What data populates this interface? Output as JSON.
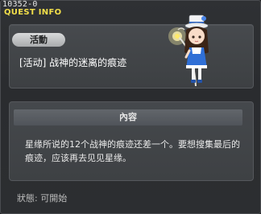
{
  "window": {
    "quest_id": "10352-0",
    "title": "QUEST INFO"
  },
  "quest": {
    "category_badge": "活動",
    "name": "[活动] 战神的迷离的痕迹"
  },
  "content": {
    "header": "內容",
    "description": "星缘所说的12个战神的痕迹还差一个。要想搜集最后的痕迹，应该再去见见星缘。"
  },
  "status": {
    "text": "狀態: 可開始"
  },
  "colors": {
    "title": "#f3df4a",
    "panel": "#44474b",
    "background": "#2c2e31"
  },
  "icons": {
    "npc": "npc-girl-with-lantern-staff"
  }
}
